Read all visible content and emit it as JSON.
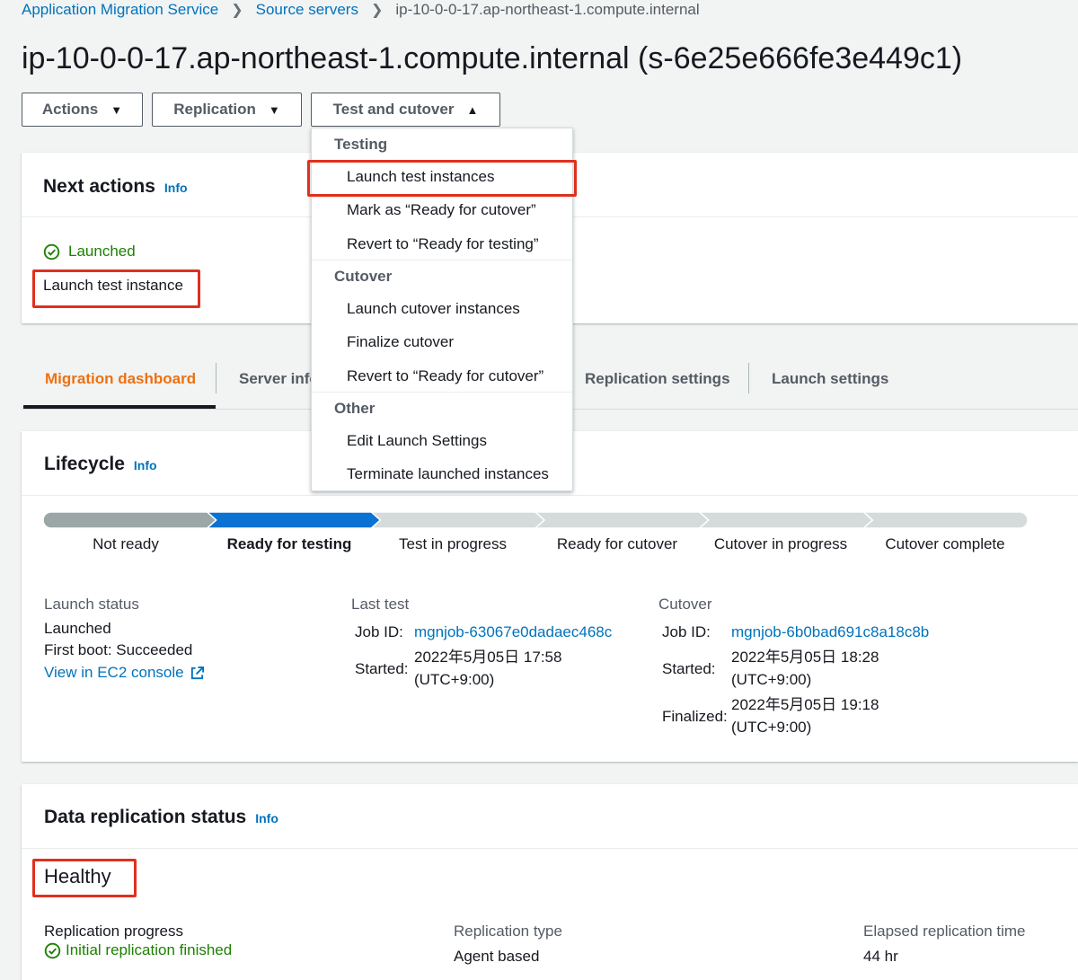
{
  "breadcrumb": {
    "items": [
      "Application Migration Service",
      "Source servers",
      "ip-10-0-0-17.ap-northeast-1.compute.internal"
    ]
  },
  "page_title": "ip-10-0-0-17.ap-northeast-1.compute.internal (s-6e25e666fe3e449c1)",
  "toolbar": {
    "actions_label": "Actions",
    "replication_label": "Replication",
    "test_cutover_label": "Test and cutover"
  },
  "dropdown": {
    "groups": [
      {
        "label": "Testing",
        "items": [
          "Launch test instances",
          "Mark as “Ready for cutover”",
          "Revert to “Ready for testing”"
        ]
      },
      {
        "label": "Cutover",
        "items": [
          "Launch cutover instances",
          "Finalize cutover",
          "Revert to “Ready for cutover”"
        ]
      },
      {
        "label": "Other",
        "items": [
          "Edit Launch Settings",
          "Terminate launched instances"
        ]
      }
    ]
  },
  "next_actions": {
    "title": "Next actions",
    "info": "Info",
    "status": "Launched",
    "action_text": "Launch test instance"
  },
  "tabs": {
    "items": [
      "Migration dashboard",
      "Server info",
      "Replication settings",
      "Launch settings"
    ]
  },
  "lifecycle": {
    "title": "Lifecycle",
    "info": "Info",
    "stages": [
      "Not ready",
      "Ready for testing",
      "Test in progress",
      "Ready for cutover",
      "Cutover in progress",
      "Cutover complete"
    ],
    "current_stage_index": 1,
    "launch_status": {
      "label": "Launch status",
      "value": "Launched",
      "first_boot": "First boot: Succeeded",
      "ec2_link": "View in EC2 console"
    },
    "last_test": {
      "label": "Last test",
      "job_id_label": "Job ID:",
      "job_id": "mgnjob-63067e0dadaec468c",
      "started_label": "Started:",
      "started_date": "2022年5月05日 17:58",
      "started_tz": "(UTC+9:00)"
    },
    "cutover": {
      "label": "Cutover",
      "job_id_label": "Job ID:",
      "job_id": "mgnjob-6b0bad691c8a18c8b",
      "started_label": "Started:",
      "started_date": "2022年5月05日 18:28",
      "started_tz": "(UTC+9:00)",
      "finalized_label": "Finalized:",
      "finalized_date": "2022年5月05日 19:18",
      "finalized_tz": "(UTC+9:00)"
    }
  },
  "data_replication": {
    "title": "Data replication status",
    "info": "Info",
    "health": "Healthy",
    "progress_label": "Replication progress",
    "progress_value": "Initial replication finished",
    "type_label": "Replication type",
    "type_value": "Agent based",
    "elapsed_label": "Elapsed replication time",
    "elapsed_value": "44 hr"
  },
  "colors": {
    "link": "#0073bb",
    "success": "#1d8102",
    "active_tab": "#ec7211",
    "progress_done": "#0972d3",
    "progress_past": "#9ba7a7",
    "progress_todo": "#d5dbdb",
    "highlight": "#e0301e"
  },
  "icons": [
    "chevron-right-icon",
    "caret-down-icon",
    "caret-up-icon",
    "check-circle-icon",
    "external-link-icon"
  ]
}
